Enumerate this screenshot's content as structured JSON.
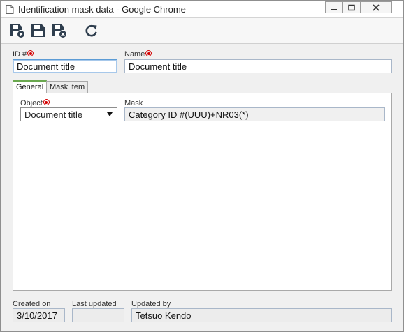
{
  "window": {
    "title": "Identification mask data - Google Chrome"
  },
  "toolbar": {
    "buttons": [
      {
        "name": "save-and-new",
        "icon": "floppy-play-icon"
      },
      {
        "name": "save",
        "icon": "floppy-icon"
      },
      {
        "name": "save-and-close",
        "icon": "floppy-close-icon"
      },
      {
        "name": "refresh",
        "icon": "refresh-icon"
      }
    ]
  },
  "form": {
    "id_label": "ID #",
    "id_value": "Document title",
    "name_label": "Name",
    "name_value": "Document title"
  },
  "tabs": [
    {
      "label": "General",
      "active": true
    },
    {
      "label": "Mask item",
      "active": false
    }
  ],
  "general": {
    "object_label": "Object",
    "object_value": "Document title",
    "mask_label": "Mask",
    "mask_value": "Category ID #(UUU)+NR03(*)"
  },
  "footer": {
    "created_label": "Created on",
    "created_value": "3/10/2017",
    "updated_label": "Last updated",
    "updated_value": "",
    "updated_by_label": "Updated by",
    "updated_by_value": "Tetsuo Kendo"
  },
  "colors": {
    "required": "#d40000",
    "focus": "#5b9bd5",
    "active_tab": "#6aa84f"
  }
}
